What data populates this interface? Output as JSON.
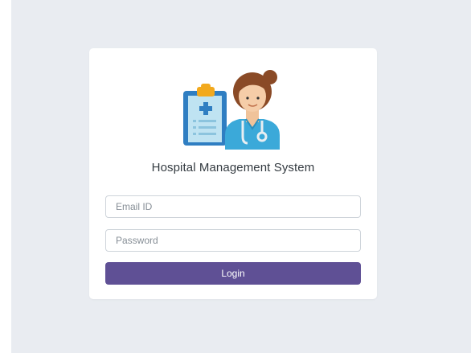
{
  "app": {
    "title": "Hospital Management System"
  },
  "form": {
    "email_placeholder": "Email ID",
    "email_value": "",
    "password_placeholder": "Password",
    "password_value": "",
    "login_label": "Login"
  },
  "illustration": {
    "icon": "doctor-with-clipboard-icon"
  },
  "colors": {
    "page_background": "#e9ecf1",
    "card_background": "#ffffff",
    "button": "#5f5095",
    "button_text": "#ffffff",
    "input_border": "#ced4da"
  }
}
